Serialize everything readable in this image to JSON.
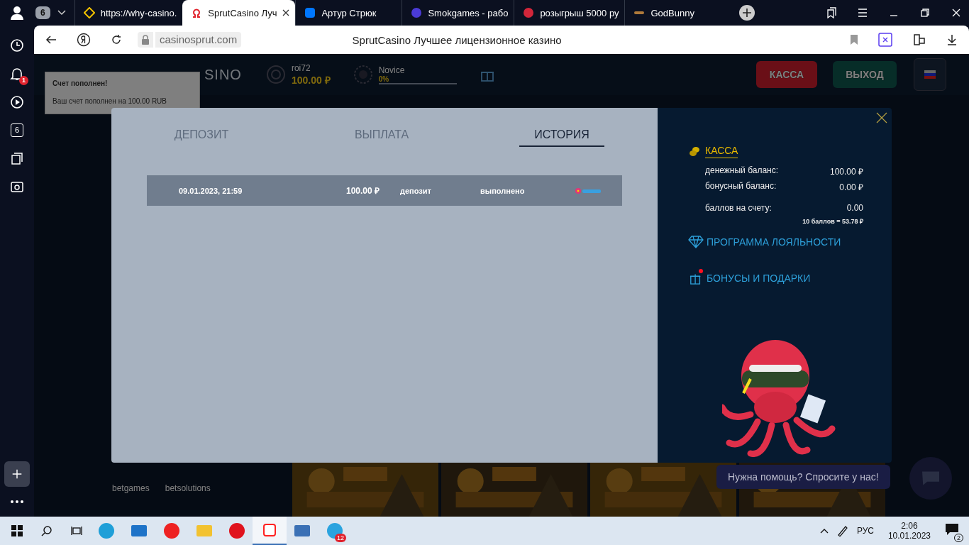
{
  "browser": {
    "profile_count": "6",
    "tabs": [
      {
        "kind": "diamond",
        "title": "https://why-casino.",
        "selected": false
      },
      {
        "kind": "omega",
        "title": "SprutCasino Луч",
        "selected": true
      },
      {
        "kind": "vk",
        "title": "Артур Стрюк",
        "selected": false
      },
      {
        "kind": "sg",
        "title": "Smokgames - рабо",
        "selected": false
      },
      {
        "kind": "chip",
        "title": "розыгрыш 5000 ру",
        "selected": false
      },
      {
        "kind": "bar",
        "title": "GodBunny",
        "selected": false
      }
    ],
    "address": "casinosprut.com",
    "page_title": "SprutCasino Лучшее лицензионное казино",
    "sidebar": {
      "notification_badge": "1",
      "count_label": "6"
    }
  },
  "site": {
    "logo_text": "SINO",
    "user": "roi72",
    "balance": "100.00 ₽",
    "level_name": "Novice",
    "level_progress": {
      "label": "0%",
      "level": 0
    },
    "buttons": [
      {
        "kind": "cash",
        "label": "КАССА"
      },
      {
        "kind": "exit",
        "label": "ВЫХОД"
      }
    ],
    "toast": {
      "title": "Счет пополнен!",
      "message": "Ваш счет пополнен на 100.00 RUB"
    },
    "providers": [
      "betgames",
      "betsolutions"
    ],
    "help": "Нужна помощь? Спросите у нас!"
  },
  "modal": {
    "tabs": [
      {
        "label": "ДЕПОЗИТ",
        "selected": false
      },
      {
        "label": "ВЫПЛАТА",
        "selected": false
      },
      {
        "label": "ИСТОРИЯ",
        "selected": true
      }
    ],
    "history": [
      {
        "date": "09.01.2023, 21:59",
        "amount": "100.00 ₽",
        "type": "депозит",
        "status": "выполнено"
      }
    ],
    "cashier": {
      "title": "КАССА",
      "balances": [
        {
          "label": "денежный баланс:",
          "value": "100.00 ₽"
        },
        {
          "label": "бонусный баланс:",
          "value": "0.00 ₽"
        }
      ],
      "points": {
        "label": "баллов на счету:",
        "value": "0.00"
      },
      "rate": "10 баллов = 53.78 ₽"
    },
    "links": [
      {
        "kind": "diamond",
        "label": "ПРОГРАММА ЛОЯЛЬНОСТИ",
        "badge": false
      },
      {
        "kind": "gift",
        "label": "БОНУСЫ И ПОДАРКИ",
        "badge": true
      }
    ]
  },
  "taskbar": {
    "apps": [
      {
        "kind": "edge",
        "selected": false
      },
      {
        "kind": "mail",
        "selected": false
      },
      {
        "kind": "yandex",
        "selected": false
      },
      {
        "kind": "folder",
        "selected": false
      },
      {
        "kind": "opera",
        "selected": false
      },
      {
        "kind": "ybrowser",
        "selected": true
      },
      {
        "kind": "pc",
        "selected": false
      },
      {
        "kind": "telegram",
        "selected": false,
        "badge": "12"
      }
    ],
    "language": "РУС",
    "time": "2:06",
    "date": "10.01.2023",
    "notifications": "2"
  }
}
